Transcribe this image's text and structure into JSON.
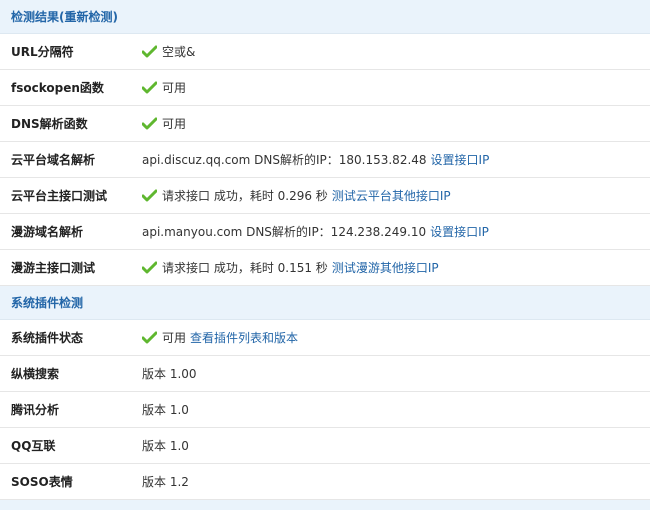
{
  "section1": {
    "title": "检测结果",
    "relink_open": "(",
    "relink": "重新检测",
    "relink_close": ")"
  },
  "rows1": [
    {
      "label": "URL分隔符",
      "text": "空或&"
    },
    {
      "label": "fsockopen函数",
      "text": "可用"
    },
    {
      "label": "DNS解析函数",
      "text": "可用"
    },
    {
      "label": "云平台域名解析",
      "text": "api.discuz.qq.com DNS解析的IP：180.153.82.48",
      "link": "设置接口IP"
    },
    {
      "label": "云平台主接口测试",
      "text": "请求接口 成功，耗时 0.296 秒",
      "link": "测试云平台其他接口IP"
    },
    {
      "label": "漫游域名解析",
      "text": "api.manyou.com DNS解析的IP：124.238.249.10",
      "link": "设置接口IP"
    },
    {
      "label": "漫游主接口测试",
      "text": "请求接口 成功，耗时 0.151 秒",
      "link": "测试漫游其他接口IP"
    }
  ],
  "section2": {
    "title": "系统插件检测"
  },
  "rows2": [
    {
      "label": "系统插件状态",
      "text": "可用",
      "link": "查看插件列表和版本"
    },
    {
      "label": "纵横搜索",
      "text": "版本 1.00"
    },
    {
      "label": "腾讯分析",
      "text": "版本 1.0"
    },
    {
      "label": "QQ互联",
      "text": "版本 1.0"
    },
    {
      "label": "SOSO表情",
      "text": "版本 1.2"
    }
  ],
  "colors": {
    "header_bg": "#eaf3fb",
    "header_text": "#2366a8",
    "link": "#2366a8",
    "check": "#5fb72f"
  }
}
